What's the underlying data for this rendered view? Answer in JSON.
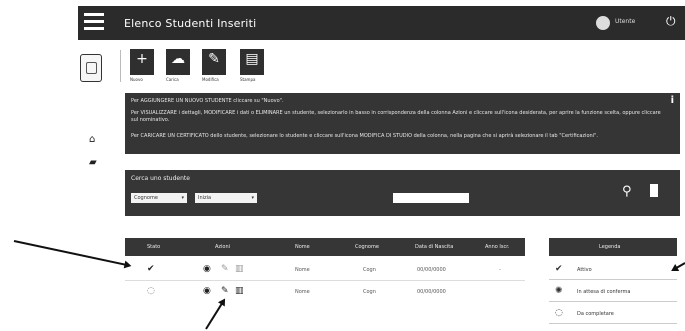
{
  "header": {
    "title": "Elenco Studenti Inseriti",
    "user": "Utente"
  },
  "toolbar": [
    {
      "label": "Nuovo",
      "icon": "plus-icon",
      "glyph": "+"
    },
    {
      "label": "Carica",
      "icon": "cloud-upload-icon",
      "glyph": "☁"
    },
    {
      "label": "Modifica",
      "icon": "pencil-icon",
      "glyph": "✎"
    },
    {
      "label": "Stampa",
      "icon": "document-icon",
      "glyph": "▤"
    }
  ],
  "info": {
    "line1": "Per AGGIUNGERE UN NUOVO STUDENTE cliccare su \"Nuovo\".",
    "line2": "Per VISUALIZZARE i dettagli, MODIFICARE i dati o ELIMINARE un studente, selezionarlo in basso in corrispondenza della colonna Azioni e cliccare sull'icona desiderata, per aprire la funzione scelta, oppure cliccare sul nominativo.",
    "line3": "Per CARICARE UN CERTIFICATO dello studente, selezionare lo studente e cliccare sull'icona MODIFICA DI STUDIO della colonna, nella pagina che si aprirà selezionare il tab \"Certificazioni\"."
  },
  "search": {
    "label": "Cerca uno studente",
    "field_select": "Cognome",
    "operator_select": "Inizia",
    "placeholder": ""
  },
  "table": {
    "headers": [
      "Stato",
      "Azioni",
      "Nome",
      "Cognome",
      "Data di Nascita",
      "Anno Iscr."
    ],
    "rows": [
      {
        "status_icon": "check-icon",
        "status_glyph": "✔",
        "nome": "Nome",
        "cognome": "Cogn",
        "data": "00/00/0000",
        "anno": "-"
      },
      {
        "status_icon": "pending-icon",
        "status_glyph": "◌",
        "nome": "Nome",
        "cognome": "Cogn",
        "data": "00/00/0000",
        "anno": ""
      }
    ]
  },
  "legend": {
    "title": "Legenda",
    "items": [
      {
        "icon": "check-icon",
        "glyph": "✔",
        "text": "Attivo"
      },
      {
        "icon": "loading-icon",
        "glyph": "✺",
        "text": "In attesa di conferma"
      },
      {
        "icon": "pending-icon",
        "glyph": "◌",
        "text": "Da completare"
      }
    ]
  }
}
